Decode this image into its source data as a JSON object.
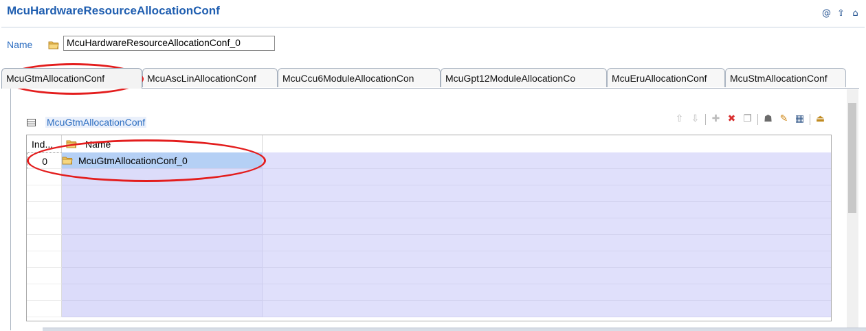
{
  "header": {
    "title": "McuHardwareResourceAllocationConf",
    "icons": [
      "at-icon",
      "arrow-up-icon",
      "home-icon"
    ]
  },
  "name_field": {
    "label": "Name",
    "value": "McuHardwareResourceAllocationConf_0"
  },
  "tabs": [
    {
      "label": "McuGtmAllocationConf",
      "active": true
    },
    {
      "label": "McuAscLinAllocationConf",
      "active": false
    },
    {
      "label": "McuCcu6ModuleAllocationCon",
      "active": false
    },
    {
      "label": "McuGpt12ModuleAllocationCo",
      "active": false
    },
    {
      "label": "McuEruAllocationConf",
      "active": false
    },
    {
      "label": "McuStmAllocationConf",
      "active": false
    }
  ],
  "table": {
    "title": "McuGtmAllocationConf",
    "columns": [
      "Ind...",
      "Name"
    ],
    "rows": [
      {
        "index": "0",
        "name": "McuGtmAllocationConf_0",
        "selected": true
      }
    ],
    "toolbar": [
      "move-up-icon",
      "move-down-icon",
      "add-icon",
      "delete-icon",
      "copy-icon",
      "user-icon",
      "edit-icon",
      "properties-icon",
      "export-icon"
    ]
  },
  "colors": {
    "title": "#1f5eb0",
    "link": "#2a6cc0",
    "annotation": "#e31d1d",
    "row_fill": "#e0e0fb",
    "selected_row": "#b5d0f5"
  }
}
